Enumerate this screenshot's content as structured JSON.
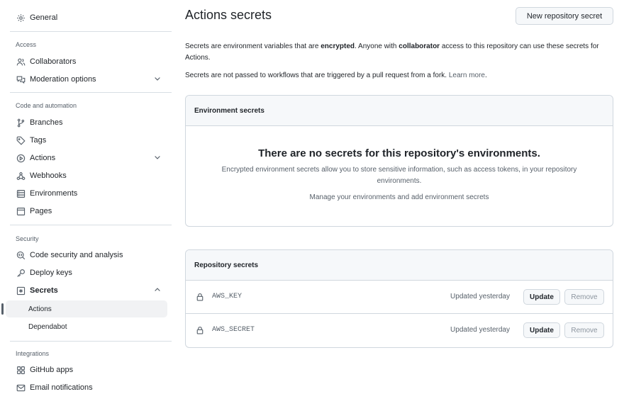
{
  "sidebar": {
    "general": "General",
    "access_label": "Access",
    "collaborators": "Collaborators",
    "moderation": "Moderation options",
    "code_label": "Code and automation",
    "branches": "Branches",
    "tags": "Tags",
    "actions": "Actions",
    "webhooks": "Webhooks",
    "environments": "Environments",
    "pages": "Pages",
    "security_label": "Security",
    "code_security": "Code security and analysis",
    "deploy_keys": "Deploy keys",
    "secrets": "Secrets",
    "secrets_actions": "Actions",
    "secrets_dependabot": "Dependabot",
    "integrations_label": "Integrations",
    "github_apps": "GitHub apps",
    "email_notifications": "Email notifications"
  },
  "main": {
    "title": "Actions secrets",
    "new_button": "New repository secret",
    "desc1_a": "Secrets are environment variables that are ",
    "desc1_b": "encrypted",
    "desc1_c": ". Anyone with ",
    "desc1_d": "collaborator",
    "desc1_e": " access to this repository can use these secrets for Actions.",
    "desc2": "Secrets are not passed to workflows that are triggered by a pull request from a fork. ",
    "learn_more": "Learn more",
    "desc2_end": "."
  },
  "env_secrets": {
    "header": "Environment secrets",
    "blank_title": "There are no secrets for this repository's environments.",
    "blank_desc": "Encrypted environment secrets allow you to store sensitive information, such as access tokens, in your repository environments.",
    "blank_link": "Manage your environments and add environment secrets"
  },
  "repo_secrets": {
    "header": "Repository secrets",
    "items": [
      {
        "name": "AWS_KEY",
        "updated": "Updated yesterday",
        "update_label": "Update",
        "remove_label": "Remove"
      },
      {
        "name": "AWS_SECRET",
        "updated": "Updated yesterday",
        "update_label": "Update",
        "remove_label": "Remove"
      }
    ]
  },
  "icons": {
    "general": "gear-icon",
    "collaborators": "people-icon",
    "moderation": "comment-discussion-icon",
    "branches": "git-branch-icon",
    "tags": "tag-icon",
    "actions": "play-icon",
    "webhooks": "webhook-icon",
    "environments": "server-icon",
    "pages": "browser-icon",
    "code_security": "codescan-icon",
    "deploy_keys": "key-icon",
    "secrets": "key-asterisk-icon",
    "github_apps": "apps-icon",
    "email_notifications": "mail-icon",
    "secret_row": "lock-icon"
  }
}
